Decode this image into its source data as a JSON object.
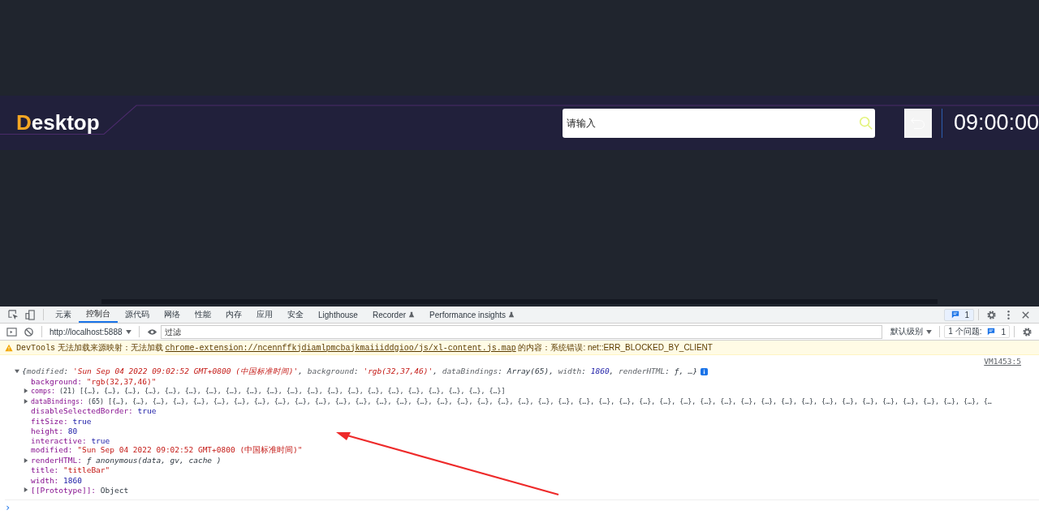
{
  "app": {
    "logo": "Desktop",
    "search": {
      "placeholder": "请输入"
    },
    "clock": "09:00:00"
  },
  "devtools": {
    "tabs": [
      {
        "label": "元素",
        "selected": false,
        "experimental": false
      },
      {
        "label": "控制台",
        "selected": true,
        "experimental": false
      },
      {
        "label": "源代码",
        "selected": false,
        "experimental": false
      },
      {
        "label": "网络",
        "selected": false,
        "experimental": false
      },
      {
        "label": "性能",
        "selected": false,
        "experimental": false
      },
      {
        "label": "内存",
        "selected": false,
        "experimental": false
      },
      {
        "label": "应用",
        "selected": false,
        "experimental": false
      },
      {
        "label": "安全",
        "selected": false,
        "experimental": false
      },
      {
        "label": "Lighthouse",
        "selected": false,
        "experimental": false
      },
      {
        "label": "Recorder",
        "selected": false,
        "experimental": true
      },
      {
        "label": "Performance insights",
        "selected": false,
        "experimental": true
      }
    ],
    "issues_badge": "1",
    "context": "http://localhost:5888",
    "filter": {
      "placeholder": "过滤"
    },
    "level": "默认级别",
    "issues_label": "1 个问题:",
    "issues_count": "1",
    "warning": {
      "source": "DevTools",
      "before": "无法加载来源映射：无法加载",
      "link": "chrome-extension://ncennffkjdiamlpmcbajkmaiiiddgioo/js/xl-content.js.map",
      "after": "的内容：系统错误: net::ERR_BLOCKED_BY_CLIENT"
    },
    "console": {
      "source_link": "VM1453:5",
      "expanded": true,
      "summary": [
        {
          "text": "{",
          "kind": "punct"
        },
        {
          "text": "modified",
          "kind": "key"
        },
        {
          "text": ": ",
          "kind": "punct"
        },
        {
          "text": "'Sun Sep 04 2022 09:02:52 GMT+0800 (中国标准时间)'",
          "kind": "string"
        },
        {
          "text": ", ",
          "kind": "punct"
        },
        {
          "text": "background",
          "kind": "key"
        },
        {
          "text": ": ",
          "kind": "punct"
        },
        {
          "text": "'rgb(32,37,46)'",
          "kind": "string"
        },
        {
          "text": ", ",
          "kind": "punct"
        },
        {
          "text": "dataBindings",
          "kind": "key"
        },
        {
          "text": ": Array(65), ",
          "kind": "punct"
        },
        {
          "text": "width",
          "kind": "key"
        },
        {
          "text": ": ",
          "kind": "punct"
        },
        {
          "text": "1860",
          "kind": "number"
        },
        {
          "text": ", ",
          "kind": "punct"
        },
        {
          "text": "renderHTML",
          "kind": "key"
        },
        {
          "text": ": ƒ, …}",
          "kind": "punct"
        }
      ],
      "properties": [
        {
          "key": "background:",
          "value": "\"rgb(32,37,46)\"",
          "kind": "string",
          "expandable": false
        },
        {
          "key": "comps:",
          "value": "(21) [{…}, {…}, {…}, {…}, {…}, {…}, {…}, {…}, {…}, {…}, {…}, {…}, {…}, {…}, {…}, {…}, {…}, {…}, {…}, {…}, {…}]",
          "kind": "preview",
          "expandable": true
        },
        {
          "key": "dataBindings:",
          "value": "(65) [{…}, {…}, {…}, {…}, {…}, {…}, {…}, {…}, {…}, {…}, {…}, {…}, {…}, {…}, {…}, {…}, {…}, {…}, {…}, {…}, {…}, {…}, {…}, {…}, {…}, {…}, {…}, {…}, {…}, {…}, {…}, {…}, {…}, {…}, {…}, {…}, {…}, {…}, {…}, {…}, {…}, {…}, {…}, {…",
          "kind": "preview",
          "expandable": true
        },
        {
          "key": "disableSelectedBorder:",
          "value": "true",
          "kind": "literal",
          "expandable": false
        },
        {
          "key": "fitSize:",
          "value": "true",
          "kind": "literal",
          "expandable": false
        },
        {
          "key": "height:",
          "value": "80",
          "kind": "literal",
          "expandable": false
        },
        {
          "key": "interactive:",
          "value": "true",
          "kind": "literal",
          "expandable": false
        },
        {
          "key": "modified:",
          "value": "\"Sun Sep 04 2022 09:02:52 GMT+0800 (中国标准时间)\"",
          "kind": "string",
          "expandable": false
        },
        {
          "key": "renderHTML:",
          "value": "ƒ anonymous(data, gv, cache )",
          "kind": "function",
          "expandable": true
        },
        {
          "key": "title:",
          "value": "\"titleBar\"",
          "kind": "string",
          "expandable": false
        },
        {
          "key": "width:",
          "value": "1860",
          "kind": "literal",
          "expandable": false
        },
        {
          "key": "[[Prototype]]:",
          "value": "Object",
          "kind": "plain",
          "expandable": true
        }
      ],
      "prompt": "›"
    }
  }
}
